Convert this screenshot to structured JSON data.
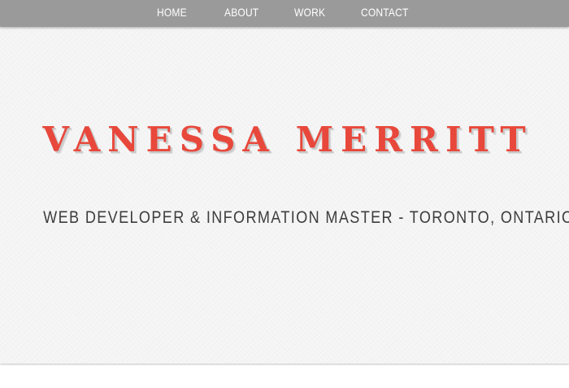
{
  "nav": {
    "items": [
      {
        "label": "HOME"
      },
      {
        "label": "ABOUT"
      },
      {
        "label": "WORK"
      },
      {
        "label": "CONTACT"
      }
    ]
  },
  "hero": {
    "name": "VANESSA MERRITT",
    "tagline": "WEB DEVELOPER & INFORMATION MASTER - TORONTO, ONTARIO"
  },
  "colors": {
    "navbar_bg": "#9a9a9a",
    "name_accent": "#e8483b",
    "tagline_text": "#3d3d3d",
    "hero_bg": "#f6f6f6"
  }
}
